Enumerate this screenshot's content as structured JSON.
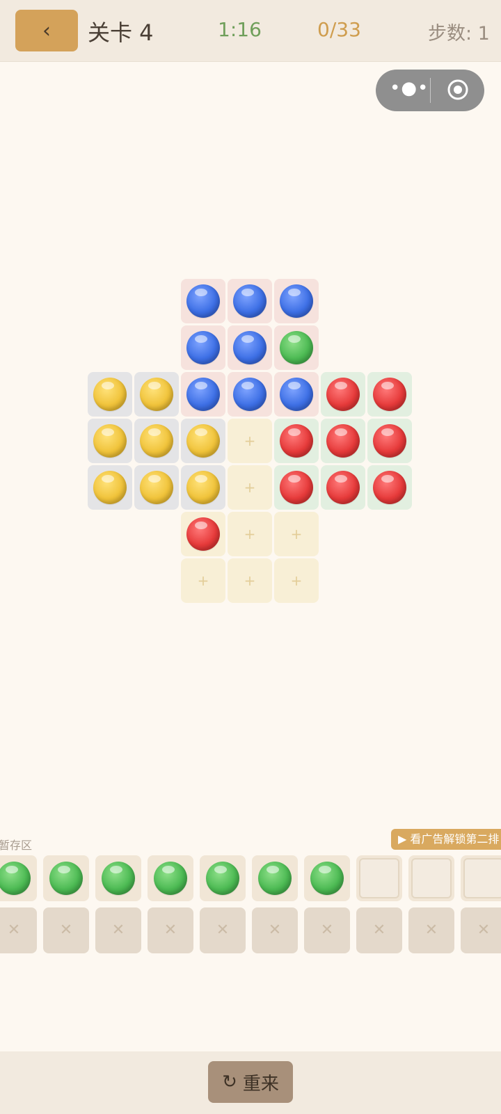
{
  "header": {
    "back_icon": "‹",
    "level": "关卡 4",
    "timer": "1:16",
    "progress": "0/33",
    "steps": "步数: 1"
  },
  "capsule": {
    "more_icon": "•●•"
  },
  "storage": {
    "label": "暂存区",
    "unlock_text": "看广告解锁第二排",
    "unlock_icon": "▶",
    "lock_icon": "✕"
  },
  "footer": {
    "restart_icon": "↻",
    "restart_label": "重来"
  },
  "board": {
    "cells": [
      {
        "bg": "pink",
        "ball": "blue"
      },
      {
        "bg": "pink",
        "ball": "blue"
      },
      {
        "bg": "pink",
        "ball": "blue"
      },
      {
        "bg": "pink",
        "ball": "blue"
      },
      {
        "bg": "pink",
        "ball": "blue"
      },
      {
        "bg": "pink",
        "ball": "green"
      },
      {
        "bg": "gray",
        "ball": "yellow"
      },
      {
        "bg": "gray",
        "ball": "yellow"
      },
      {
        "bg": "pink",
        "ball": "blue"
      },
      {
        "bg": "pink",
        "ball": "blue"
      },
      {
        "bg": "pink",
        "ball": "blue"
      },
      {
        "bg": "green",
        "ball": "red"
      },
      {
        "bg": "green",
        "ball": "red"
      },
      {
        "bg": "gray",
        "ball": "yellow"
      },
      {
        "bg": "gray",
        "ball": "yellow"
      },
      {
        "bg": "gray",
        "ball": "yellow"
      },
      {
        "bg": "yellow",
        "ball": null
      },
      {
        "bg": "green",
        "ball": "red"
      },
      {
        "bg": "green",
        "ball": "red"
      },
      {
        "bg": "green",
        "ball": "red"
      },
      {
        "bg": "gray",
        "ball": "yellow"
      },
      {
        "bg": "gray",
        "ball": "yellow"
      },
      {
        "bg": "gray",
        "ball": "yellow"
      },
      {
        "bg": "yellow",
        "ball": null
      },
      {
        "bg": "green",
        "ball": "red"
      },
      {
        "bg": "green",
        "ball": "red"
      },
      {
        "bg": "green",
        "ball": "red"
      },
      {
        "bg": "yellow",
        "ball": "red"
      },
      {
        "bg": "yellow",
        "ball": null
      },
      {
        "bg": "yellow",
        "ball": null
      },
      {
        "bg": "yellow",
        "ball": null
      },
      {
        "bg": "yellow",
        "ball": null
      },
      {
        "bg": "yellow",
        "ball": null
      }
    ]
  },
  "slots_row1": [
    "green",
    "green",
    "green",
    "green",
    "green",
    "green",
    "green",
    null,
    null,
    null
  ],
  "slots_row2_count": 10,
  "colors": {
    "accent": "#d4a25a",
    "timer": "#6f9f5a",
    "progress": "#cf9d4e"
  }
}
